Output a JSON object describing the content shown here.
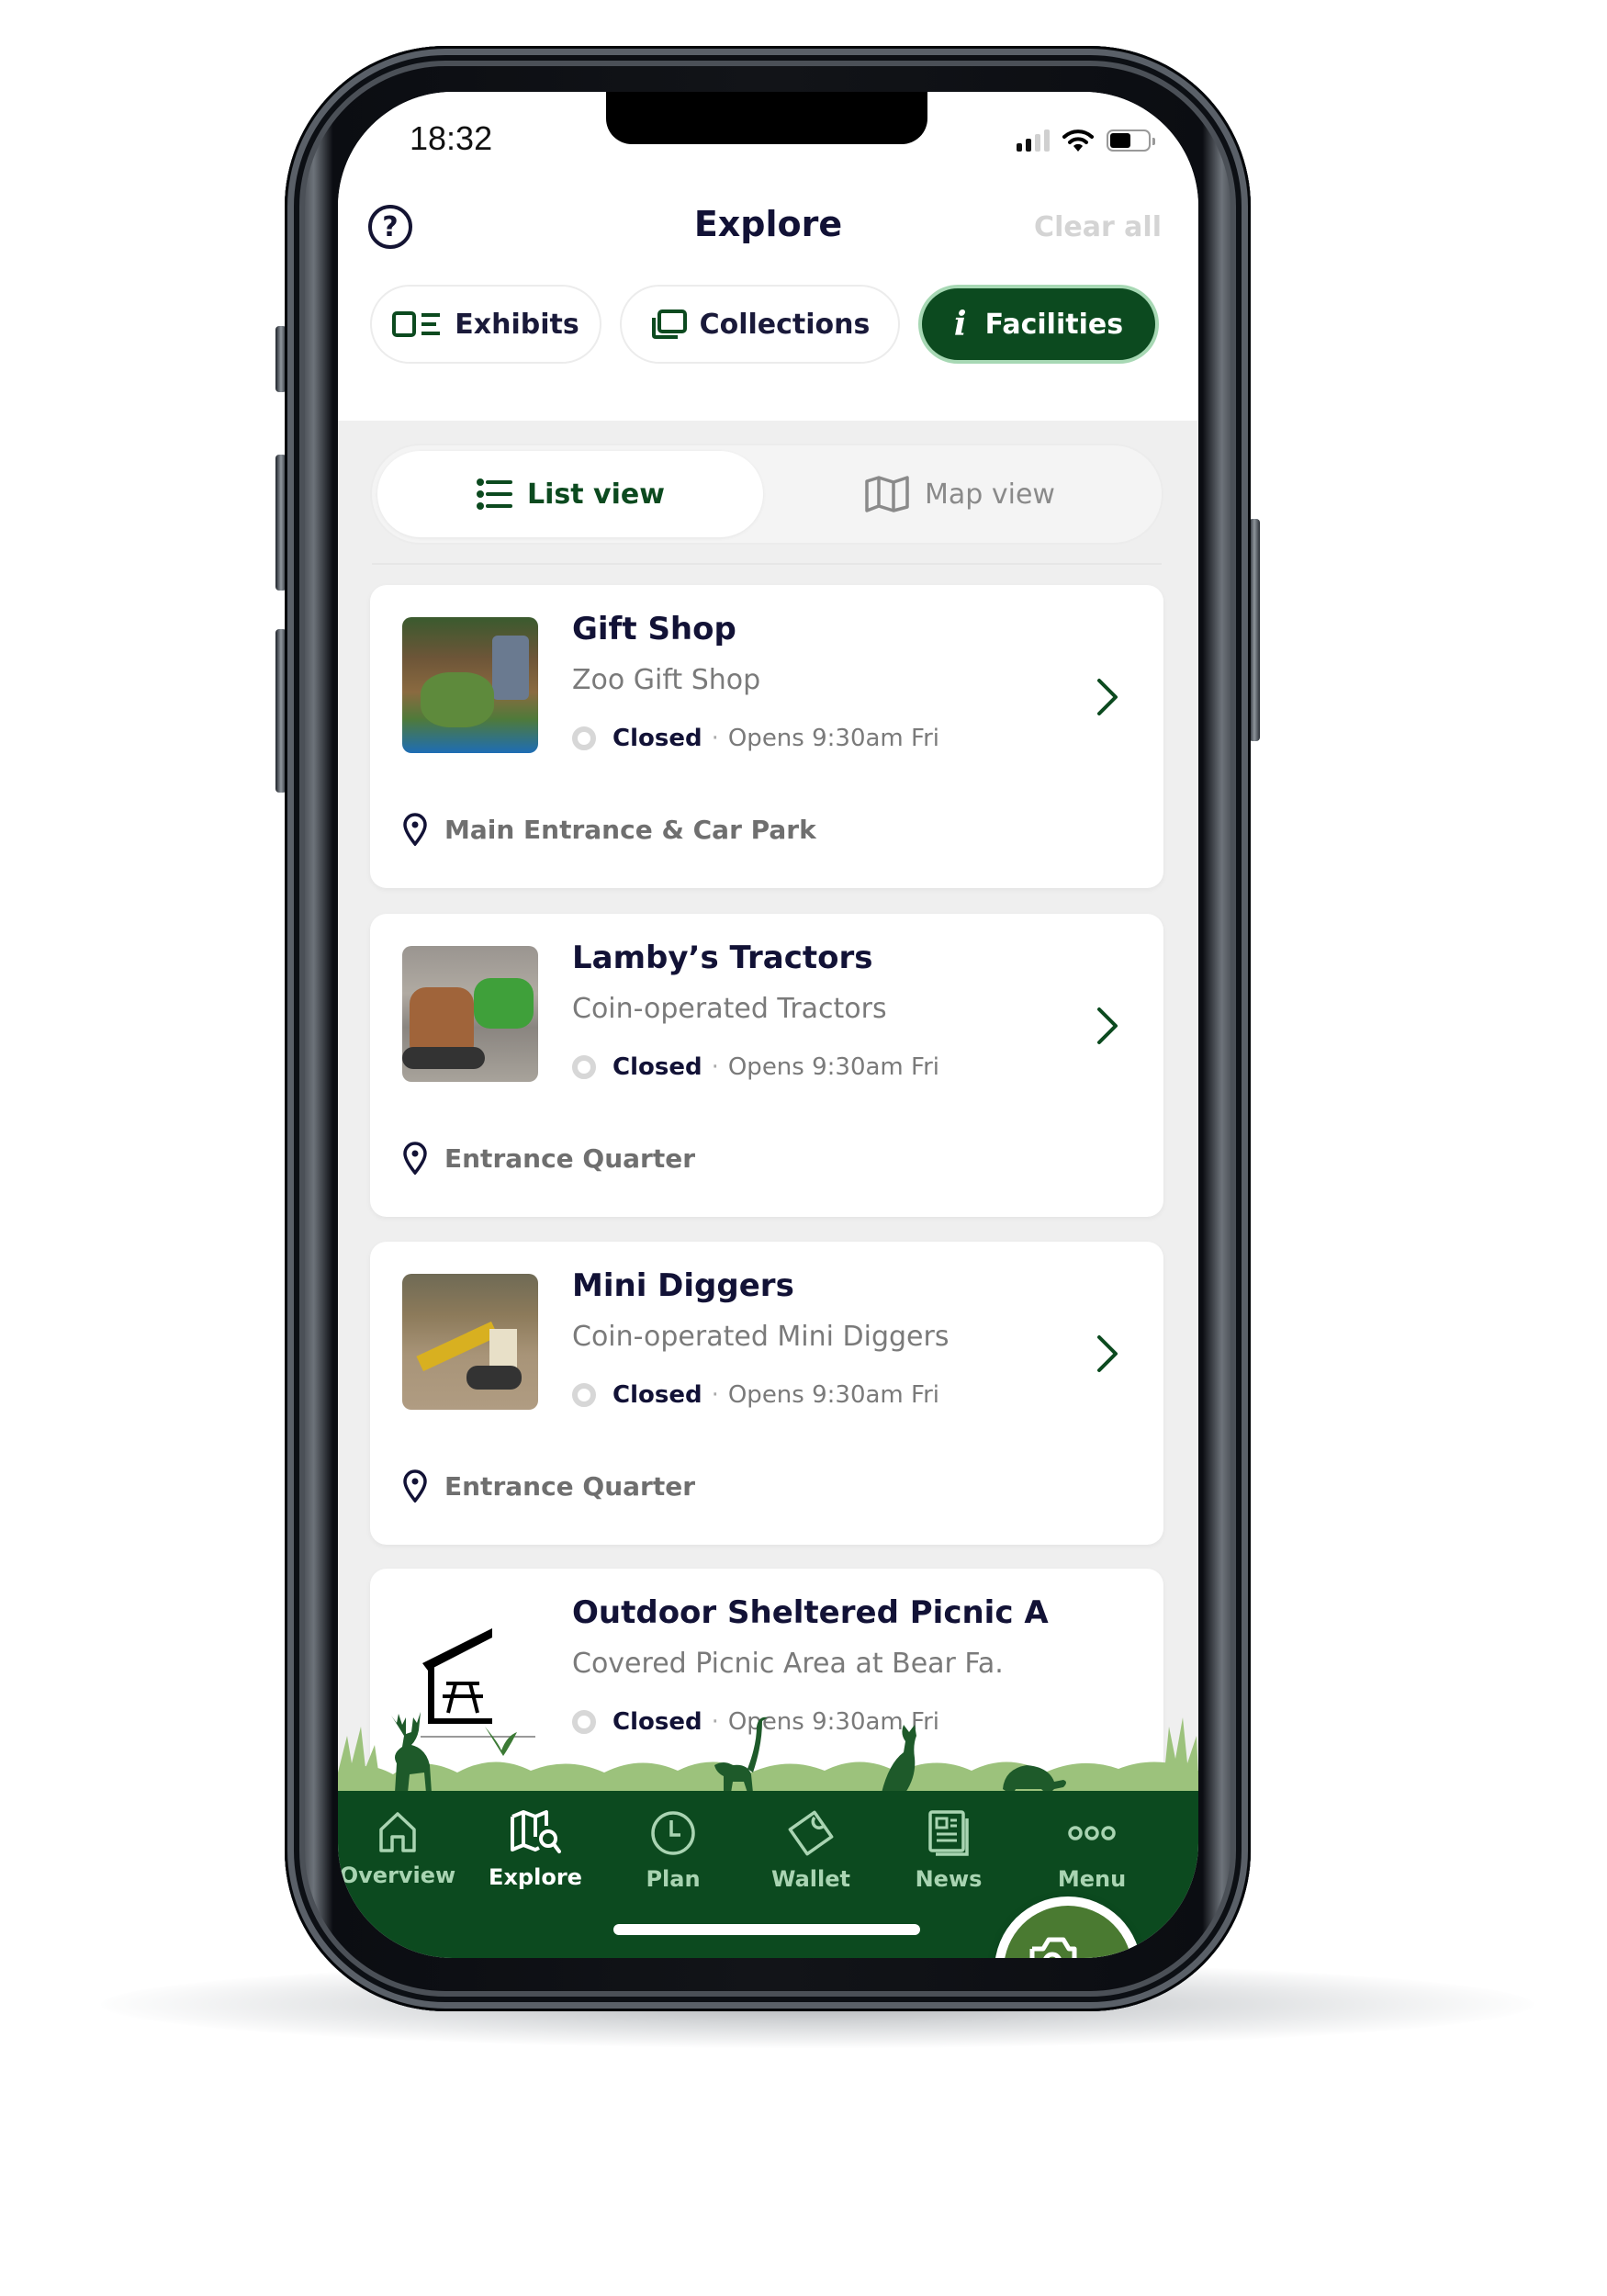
{
  "status_bar": {
    "time": "18:32",
    "signal_bars_filled": 2,
    "signal_bars_total": 4,
    "battery_level_percent": 60
  },
  "header": {
    "help_icon": "question-circle-icon",
    "title": "Explore",
    "clear_all_label": "Clear all"
  },
  "category_tabs": [
    {
      "label": "Exhibits",
      "icon": "exhibits-list-icon",
      "active": false
    },
    {
      "label": "Collections",
      "icon": "collections-stack-icon",
      "active": false
    },
    {
      "label": "Facilities",
      "icon": "info-icon",
      "active": true
    }
  ],
  "view_toggle": {
    "list_label": "List view",
    "map_label": "Map view",
    "selected": "List view"
  },
  "facilities": [
    {
      "title": "Gift Shop",
      "subtitle": "Zoo Gift Shop",
      "status": "Closed",
      "opens": "Opens 9:30am Fri",
      "location": "Main Entrance & Car Park",
      "thumbnail": "gift-shop-photo"
    },
    {
      "title": "Lamby’s Tractors",
      "subtitle": "Coin-operated Tractors",
      "status": "Closed",
      "opens": "Opens 9:30am Fri",
      "location": "Entrance Quarter",
      "thumbnail": "tractors-photo"
    },
    {
      "title": "Mini Diggers",
      "subtitle": "Coin-operated Mini Diggers",
      "status": "Closed",
      "opens": "Opens 9:30am Fri",
      "location": "Entrance Quarter",
      "thumbnail": "mini-diggers-photo"
    },
    {
      "title": "Outdoor Sheltered Picnic A",
      "subtitle": "Covered Picnic Area at Bear Fa.",
      "status": "Closed",
      "opens": "Opens 9:30am Fri",
      "location": "",
      "thumbnail": "picnic-shelter-icon"
    }
  ],
  "status_separator": "·",
  "fab": {
    "icon": "camera-scan-icon"
  },
  "bottom_nav": [
    {
      "label": "Overview",
      "icon": "home-icon",
      "active": false
    },
    {
      "label": "Explore",
      "icon": "map-search-icon",
      "active": true
    },
    {
      "label": "Plan",
      "icon": "clock-icon",
      "active": false
    },
    {
      "label": "Wallet",
      "icon": "ticket-icon",
      "active": false
    },
    {
      "label": "News",
      "icon": "newspaper-icon",
      "active": false
    },
    {
      "label": "Menu",
      "icon": "more-dots-icon",
      "active": false
    }
  ],
  "colors": {
    "brand_green": "#0c4a1f",
    "fab_green": "#4a7a31",
    "nav_inactive": "#a9d4b2",
    "text_dark": "#121236",
    "text_muted": "#7a7a7a",
    "clear_all_disabled": "#d4d4d4"
  }
}
